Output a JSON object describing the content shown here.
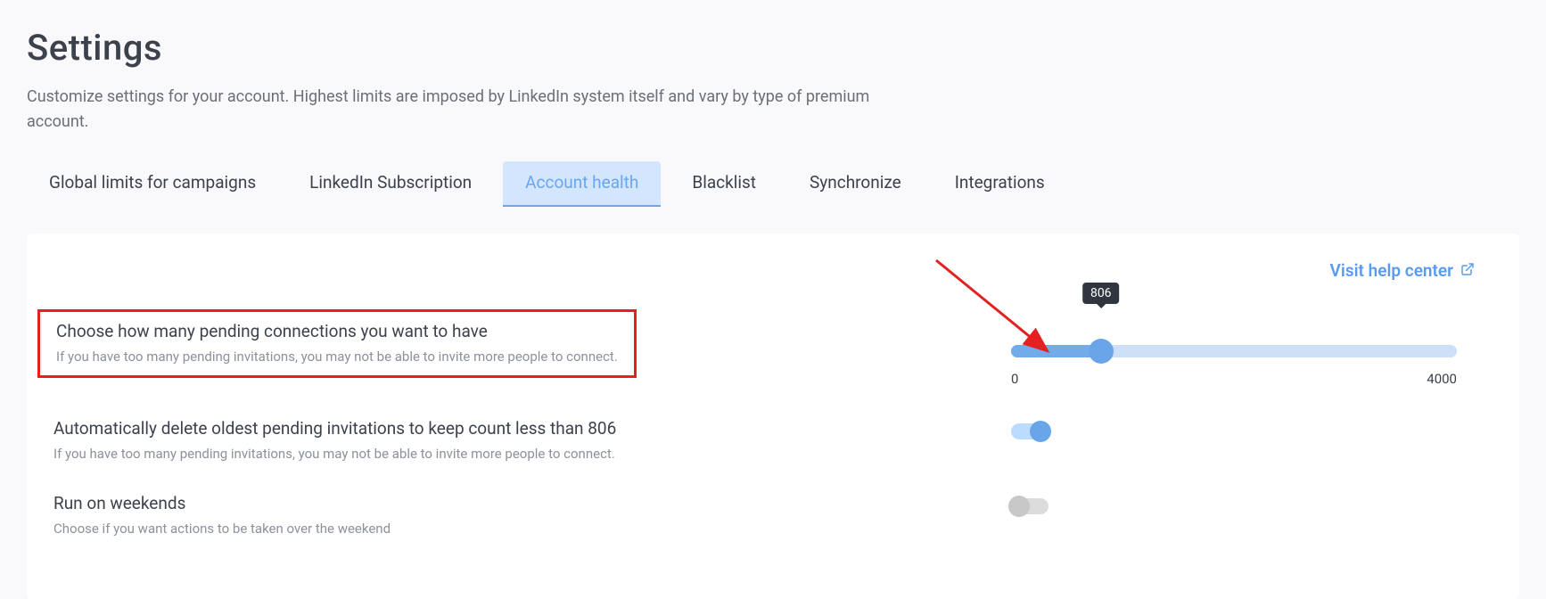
{
  "page": {
    "title": "Settings",
    "subtitle": "Customize settings for your account. Highest limits are imposed by LinkedIn system itself and vary by type of premium account."
  },
  "tabs": [
    {
      "label": "Global limits for campaigns",
      "active": false
    },
    {
      "label": "LinkedIn Subscription",
      "active": false
    },
    {
      "label": "Account health",
      "active": true
    },
    {
      "label": "Blacklist",
      "active": false
    },
    {
      "label": "Synchronize",
      "active": false
    },
    {
      "label": "Integrations",
      "active": false
    }
  ],
  "help_link": {
    "label": "Visit help center"
  },
  "pending_connections": {
    "title": "Choose how many pending connections you want to have",
    "description": "If you have too many pending invitations, you may not be able to invite more people to connect.",
    "slider": {
      "min": 0,
      "max": 4000,
      "value": 806,
      "min_label": "0",
      "max_label": "4000",
      "value_label": "806"
    }
  },
  "auto_delete": {
    "title": "Automatically delete oldest pending invitations to keep count less than 806",
    "description": "If you have too many pending invitations, you may not be able to invite more people to connect.",
    "toggle_on": true
  },
  "weekends": {
    "title": "Run on weekends",
    "description": "Choose if you want actions to be taken over the weekend",
    "toggle_on": false
  }
}
